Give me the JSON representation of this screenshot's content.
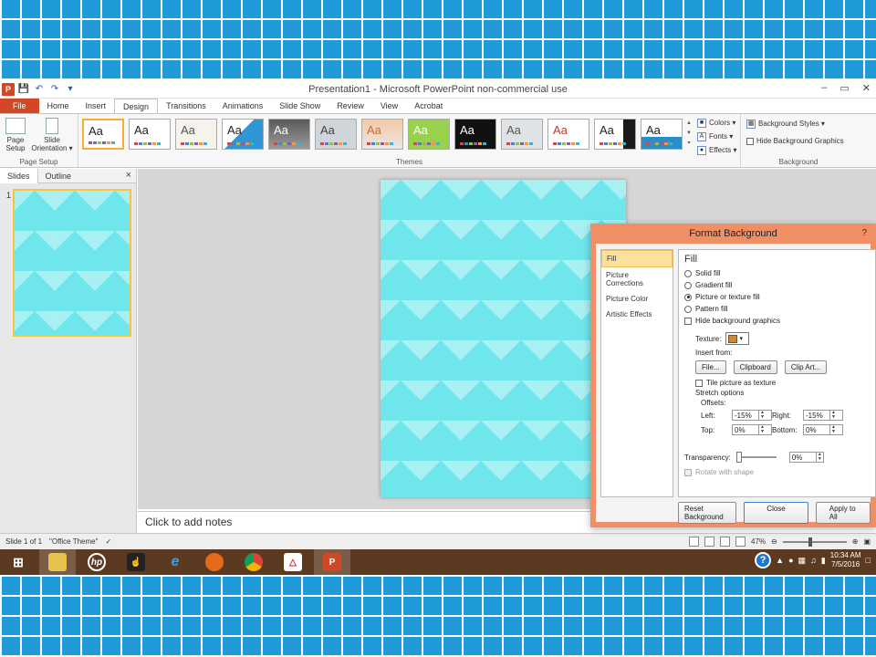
{
  "window": {
    "title": "Presentation1 - Microsoft PowerPoint non-commercial use",
    "controls": [
      "–",
      "▭",
      "✕"
    ]
  },
  "quick_access": [
    "save-icon",
    "undo-icon",
    "redo-icon",
    "customize-icon"
  ],
  "tabs": [
    {
      "label": "File"
    },
    {
      "label": "Home"
    },
    {
      "label": "Insert"
    },
    {
      "label": "Design"
    },
    {
      "label": "Transitions"
    },
    {
      "label": "Animations"
    },
    {
      "label": "Slide Show"
    },
    {
      "label": "Review"
    },
    {
      "label": "View"
    },
    {
      "label": "Acrobat"
    }
  ],
  "active_tab": "Design",
  "ribbon": {
    "page_setup": {
      "label": "Page Setup",
      "page_setup_btn": "Page Setup",
      "orientation_btn": "Slide Orientation ▾"
    },
    "themes": {
      "label": "Themes",
      "thumb_text": "Aa",
      "count": 13,
      "selected_index": 0
    },
    "theme_menu": {
      "colors": "Colors ▾",
      "fonts": "Fonts ▾",
      "effects": "Effects ▾"
    },
    "background": {
      "label": "Background",
      "styles": "Background Styles ▾",
      "hide_graphics": "Hide Background Graphics"
    }
  },
  "pane": {
    "tab_slides": "Slides",
    "tab_outline": "Outline",
    "close": "×",
    "slide_number": "1"
  },
  "notes": {
    "placeholder": "Click to add notes"
  },
  "status": {
    "slide_info": "Slide 1 of 1",
    "theme": "\"Office Theme\"",
    "zoom": "47%"
  },
  "dialog": {
    "title": "Format Background",
    "help": "?",
    "categories": [
      "Fill",
      "Picture Corrections",
      "Picture Color",
      "Artistic Effects"
    ],
    "active_category": "Fill",
    "fill_title": "Fill",
    "options": [
      {
        "label": "Solid fill",
        "selected": false
      },
      {
        "label": "Gradient fill",
        "selected": false
      },
      {
        "label": "Picture or texture fill",
        "selected": true
      },
      {
        "label": "Pattern fill",
        "selected": false
      }
    ],
    "hide_bg_graphics": "Hide background graphics",
    "texture_label": "Texture:",
    "insert_from": "Insert from:",
    "file_btn": "File...",
    "clipboard_btn": "Clipboard",
    "clipart_btn": "Clip Art...",
    "tile_label": "Tile picture as texture",
    "stretch_options": "Stretch options",
    "offsets_label": "Offsets:",
    "offsets": {
      "left_label": "Left:",
      "left_value": "-15%",
      "right_label": "Right:",
      "right_value": "-15%",
      "top_label": "Top:",
      "top_value": "0%",
      "bottom_label": "Bottom:",
      "bottom_value": "0%"
    },
    "transparency_label": "Transparency:",
    "transparency_value": "0%",
    "rotate_label": "Rotate with shape",
    "reset_btn": "Reset Background",
    "close_btn": "Close",
    "apply_btn": "Apply to All"
  },
  "taskbar": {
    "time": "10:34 AM",
    "date": "7/5/2016",
    "items": [
      "windows-start",
      "file-explorer",
      "hp",
      "mouse-app",
      "internet-explorer",
      "firefox",
      "chrome",
      "acrobat",
      "powerpoint"
    ]
  },
  "colors": {
    "file_tab": "#d24726",
    "dialog_border": "#f08f63",
    "chevron_dark": "#6ee6ec",
    "chevron_light": "#a9f0f2",
    "taskbar": "#5c3a22",
    "backdrop": "#1e9ad8"
  }
}
